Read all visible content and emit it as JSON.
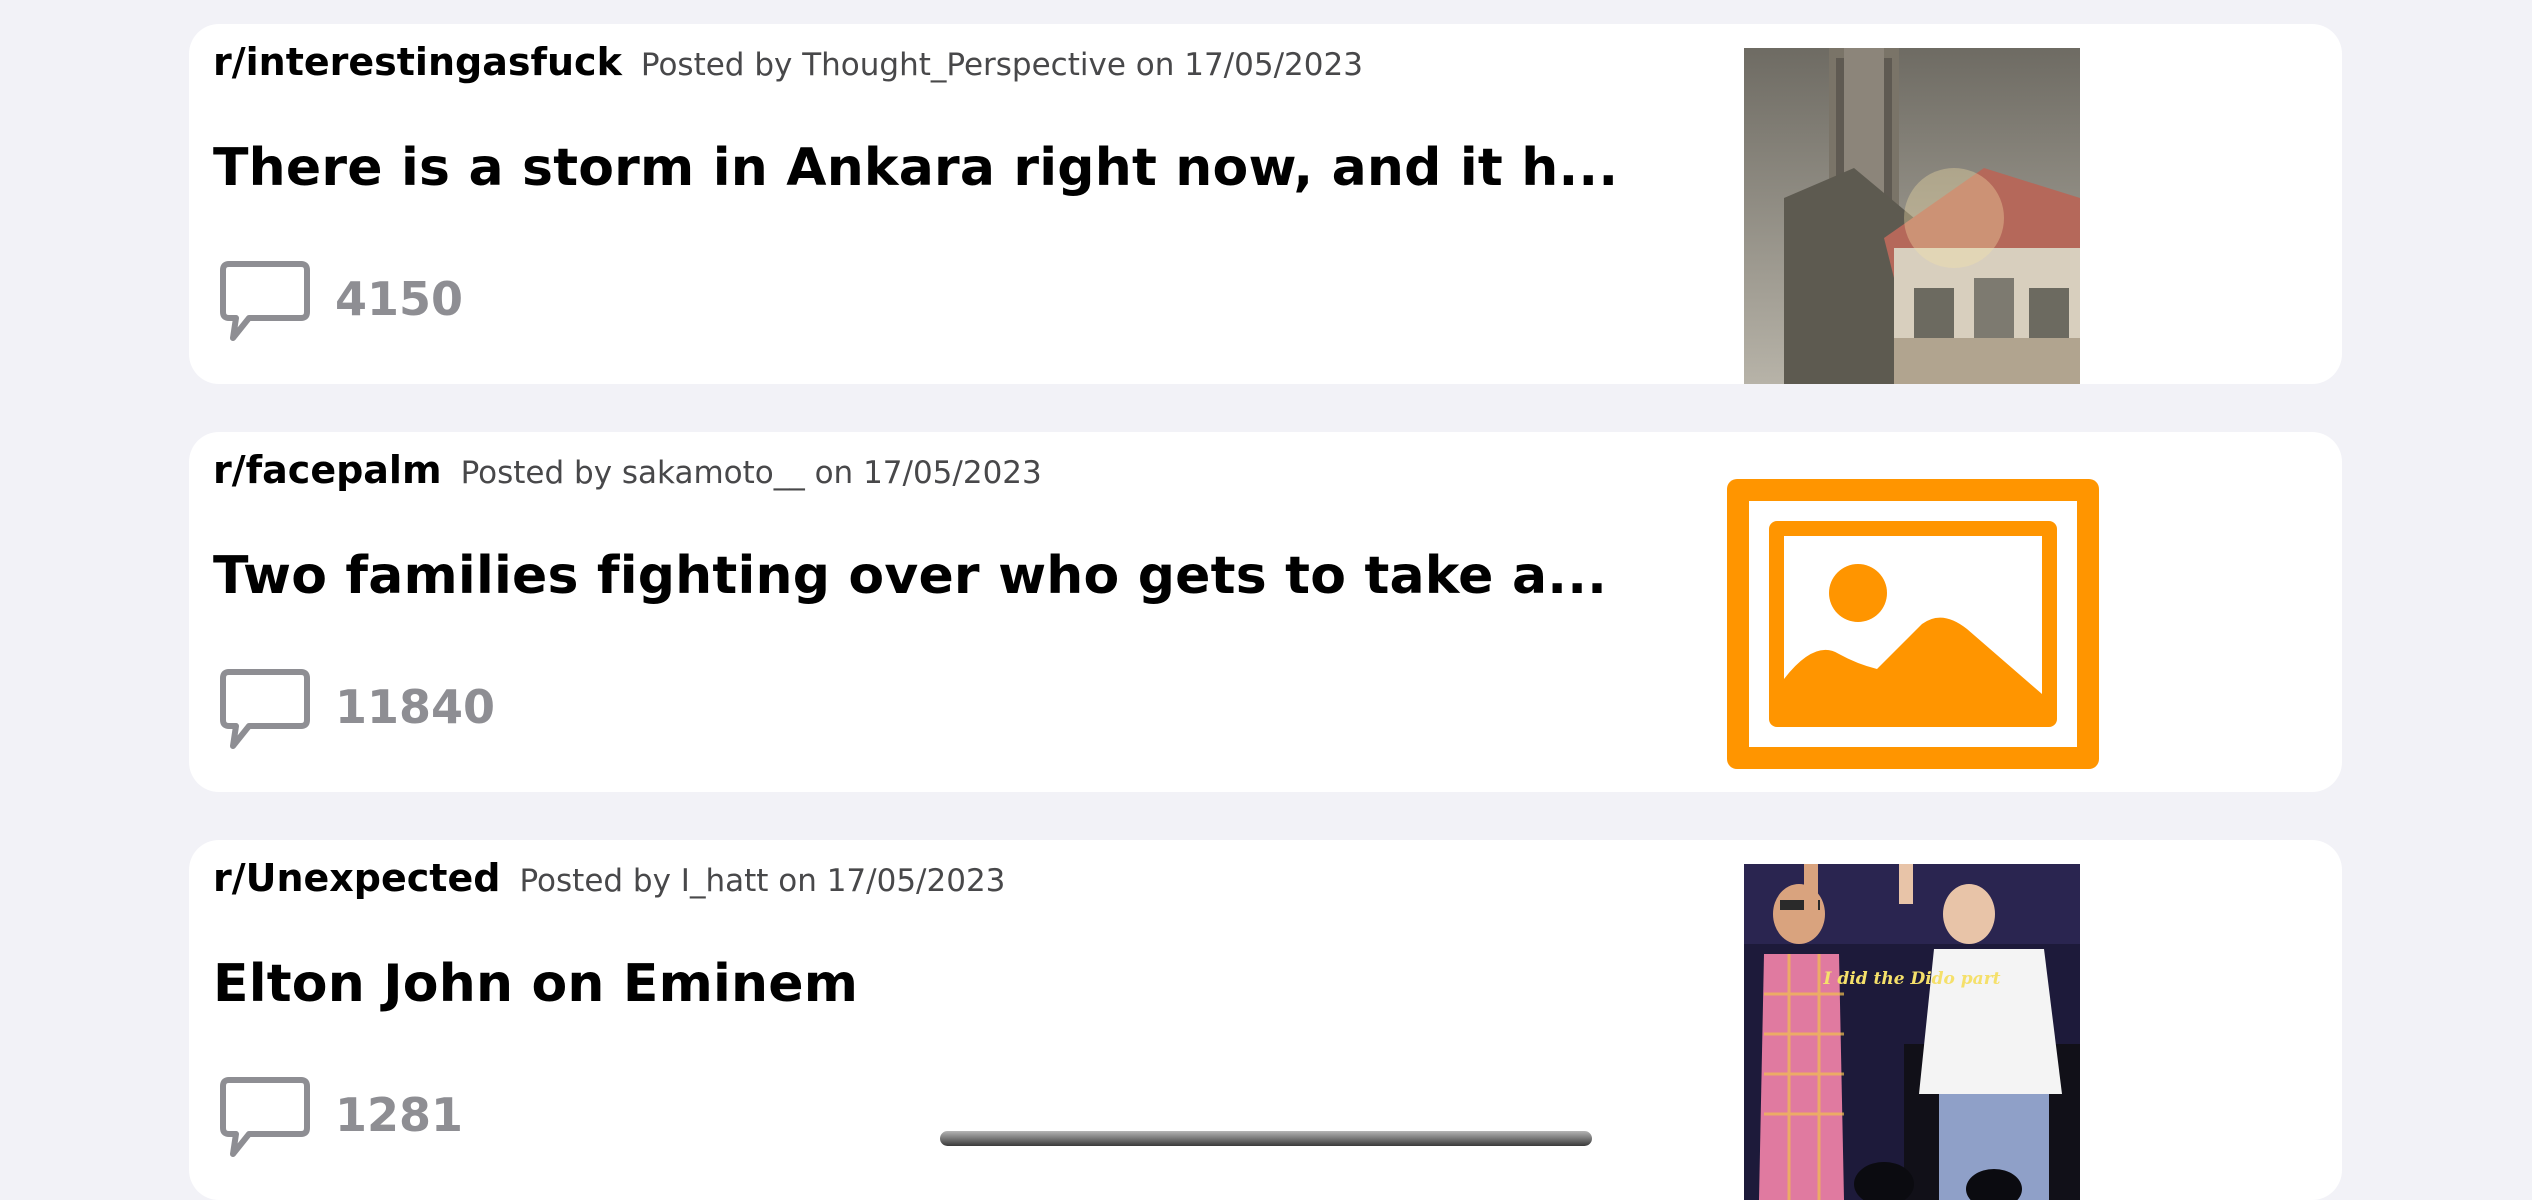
{
  "posts": [
    {
      "subreddit": "r/interestingasfuck",
      "posted": "Posted by Thought_Perspective on 17/05/2023",
      "title": "There is a storm in Ankara right now, and it h...",
      "comments": "4150",
      "thumbnail": "storm-building-photo"
    },
    {
      "subreddit": "r/facepalm",
      "posted": "Posted by sakamoto__ on 17/05/2023",
      "title": "Two families fighting over who gets to take a...",
      "comments": "11840",
      "thumbnail": "image-placeholder-icon"
    },
    {
      "subreddit": "r/Unexpected",
      "posted": "Posted by I_hatt on 17/05/2023",
      "title": "Elton John on Eminem",
      "comments": "1281",
      "thumbnail": "elton-eminem-photo",
      "thumbnail_caption": "I did the Dido part"
    }
  ],
  "colors": {
    "background": "#f2f2f7",
    "card": "#ffffff",
    "placeholder_accent": "#ff9500",
    "comment_count": "#8e8e93"
  }
}
